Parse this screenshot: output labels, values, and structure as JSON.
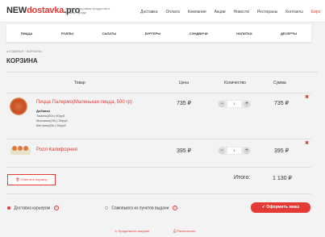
{
  "header": {
    "logo_part1": "NEW",
    "logo_part2": "dostavka",
    "logo_part3": ".pro",
    "tagline": "Служба доставки продуктов в вашем городе",
    "nav": [
      "Доставка",
      "Оплата",
      "Компания",
      "Акции",
      "Новости",
      "Рестораны",
      "Контакты",
      "Евро"
    ]
  },
  "categories": [
    "ПИЦЦА",
    "РОЛЛЫ",
    "САЛАТЫ",
    "БУРГЕРЫ",
    "СЭНДВИЧИ",
    "НАПИТКИ",
    "ДЕСЕРТЫ"
  ],
  "breadcrumb": "◂ ГЛАВНАЯ · КОРЗИНА",
  "page_title": "КОРЗИНА",
  "table": {
    "headers": [
      "Товар",
      "Цена",
      "Количество",
      "Сумма"
    ],
    "rows": [
      {
        "name": "Пицца Палермо(Маленькая пицца, 500 гр)",
        "price": "735 ₽",
        "qty": "1",
        "sum": "735 ₽"
      },
      {
        "name": "Ролл Калифорния",
        "price": "395 ₽",
        "qty": "1",
        "sum": "395 ₽"
      }
    ],
    "additions_title": "Добавки",
    "additions": [
      "Томаты(50г.) 50руб",
      "Маслины(25г.) 30руб",
      "Ветчина(50г.) 50руб"
    ]
  },
  "clear_label": "Очистить корзину",
  "total_label": "Итого:",
  "total_value": "1 130 ₽",
  "delivery": {
    "courier": "Доставка курьером",
    "pickup": "Самовывоз из пунктов выдачи"
  },
  "order_button": "Оформить заказ",
  "footer": {
    "continue": "Продолжить покупки",
    "print": "Распечатать"
  },
  "colors": {
    "accent": "#e53935"
  }
}
